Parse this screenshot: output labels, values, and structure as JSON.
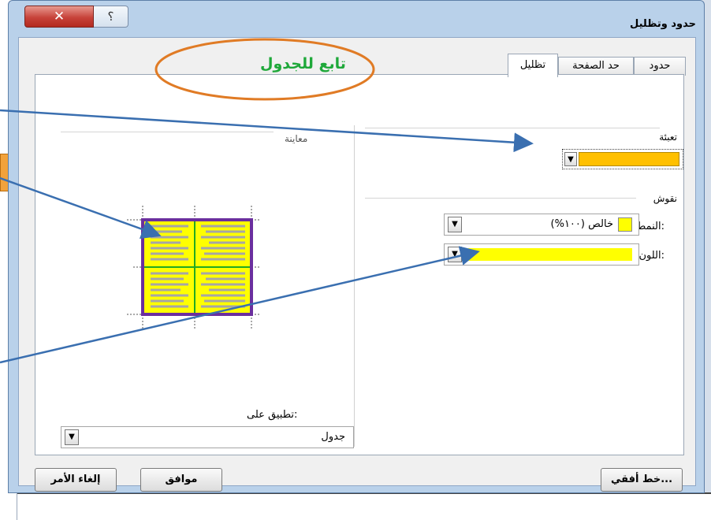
{
  "window": {
    "title": "حدود وتظليل",
    "close_glyph": "✕",
    "help_glyph": "؟"
  },
  "tabs": [
    {
      "label": "حدود"
    },
    {
      "label": "حد الصفحة"
    },
    {
      "label": "تظليل",
      "selected": true
    }
  ],
  "fill": {
    "label": "تعبئة",
    "color": "#ffc000"
  },
  "patterns": {
    "label": "نقوش",
    "style_label": "النمط:",
    "style_value": "خالص (١٠٠%)",
    "style_color": "#ffff00",
    "color_label": "اللون:",
    "color_value": "#ffff00"
  },
  "preview": {
    "label": "معاينة",
    "border_color": "#6b2f9e",
    "fill_color": "#ffff00",
    "line_color": "#a6a6a6",
    "divider_color": "#22aa22"
  },
  "apply_to": {
    "label": "تطبيق على:",
    "value": "جدول"
  },
  "buttons": {
    "horizontal_line": "خط أفقي...",
    "ok": "موافق",
    "cancel": "إلغاء الأمر"
  },
  "annotation": {
    "text": "تابع للجدول",
    "ellipse_color": "#e07b25",
    "arrow_color": "#3a6fb0"
  }
}
